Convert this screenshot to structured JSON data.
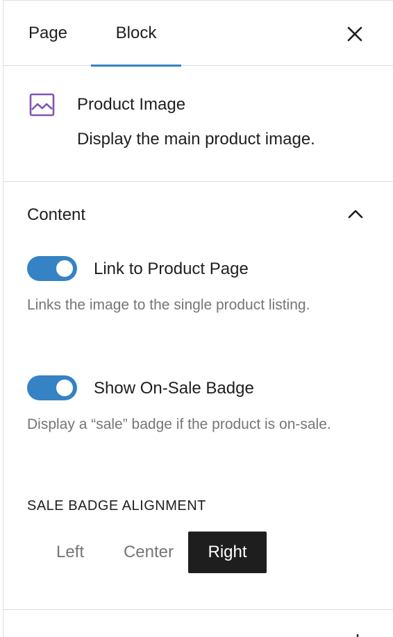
{
  "tabs": {
    "page_label": "Page",
    "block_label": "Block",
    "active": "Block"
  },
  "block": {
    "title": "Product Image",
    "description": "Display the main product image.",
    "icon": "image-icon",
    "icon_color": "#7f54b3"
  },
  "content": {
    "title": "Content",
    "expanded": true,
    "toggles": [
      {
        "label": "Link to Product Page",
        "help": "Links the image to the single product listing.",
        "checked": true
      },
      {
        "label": "Show On-Sale Badge",
        "help": "Display a “sale” badge if the product is on-sale.",
        "checked": true
      }
    ],
    "alignment": {
      "label": "SALE BADGE ALIGNMENT",
      "options": [
        "Left",
        "Center",
        "Right"
      ],
      "selected": "Right"
    }
  },
  "colors": {
    "accent": "#3582c4",
    "selected_bg": "#1e1e1e",
    "help_text": "#757575"
  }
}
